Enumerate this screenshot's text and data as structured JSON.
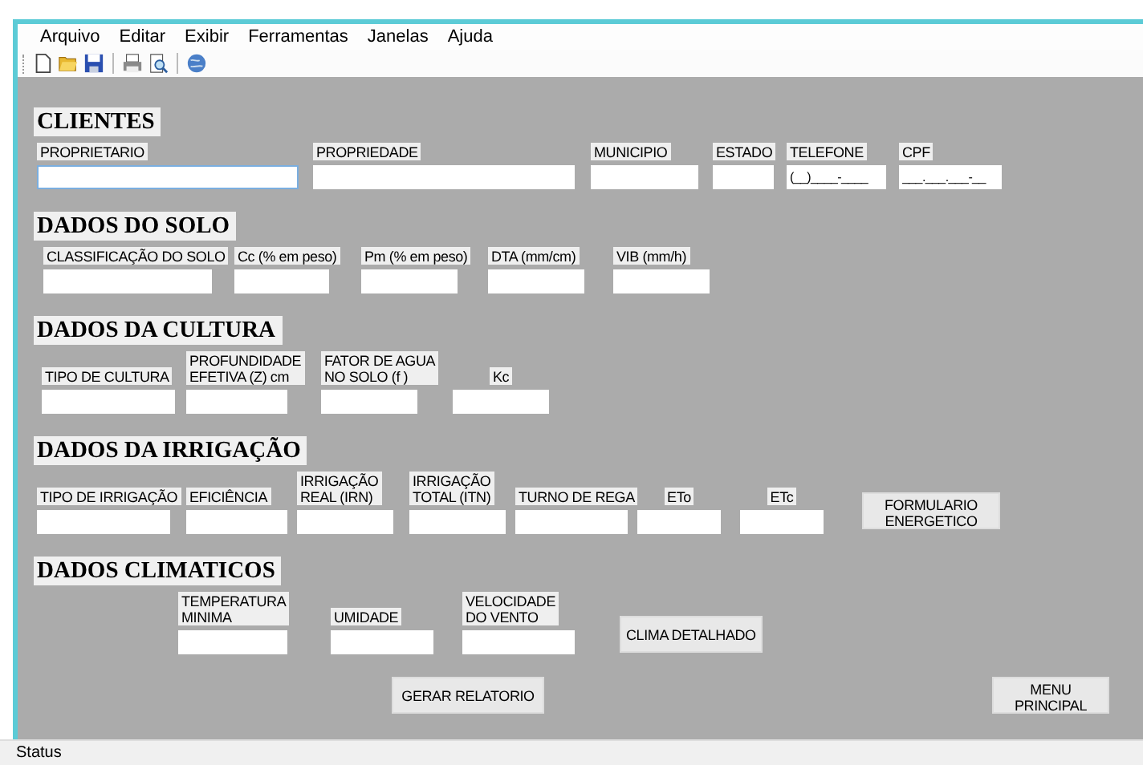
{
  "menu": [
    "Arquivo",
    "Editar",
    "Exibir",
    "Ferramentas",
    "Janelas",
    "Ajuda"
  ],
  "toolbar": [
    {
      "kind": "new"
    },
    {
      "kind": "open"
    },
    {
      "kind": "save"
    },
    {
      "kind": "separator"
    },
    {
      "kind": "print"
    },
    {
      "kind": "preview"
    },
    {
      "kind": "separator"
    },
    {
      "kind": "help"
    }
  ],
  "sections": [
    {
      "title": "CLIENTES",
      "fields": [
        {
          "label": [
            "PROPRIETARIO"
          ],
          "focused": true
        },
        {
          "label": [
            "PROPRIEDADE"
          ],
          "focused": false
        },
        {
          "label": [
            "MUNICIPIO"
          ],
          "focused": false
        },
        {
          "label": [
            "ESTADO"
          ],
          "focused": false
        },
        {
          "label": [
            "TELEFONE"
          ],
          "value": "(__)____-____",
          "focused": false
        },
        {
          "label": [
            "CPF"
          ],
          "value": "___.___.___-__",
          "focused": false
        }
      ]
    },
    {
      "title": "DADOS DO SOLO",
      "fields": [
        {
          "label": [
            "CLASSIFICAÇÃO DO SOLO"
          ],
          "focused": false
        },
        {
          "label": [
            "Cc (% em peso)"
          ],
          "focused": false
        },
        {
          "label": [
            "Pm (% em peso)"
          ],
          "focused": false
        },
        {
          "label": [
            "DTA  (mm/cm)"
          ],
          "focused": false
        },
        {
          "label": [
            "VIB  (mm/h)"
          ],
          "focused": false
        }
      ]
    },
    {
      "title": "DADOS DA CULTURA",
      "fields": [
        {
          "label": [
            "TIPO DE CULTURA"
          ],
          "focused": false
        },
        {
          "label": [
            "PROFUNDIDADE",
            "EFETIVA (Z) cm"
          ],
          "focused": false
        },
        {
          "label": [
            "FATOR DE AGUA",
            "NO SOLO (f )"
          ],
          "focused": false
        },
        {
          "label": [
            "Kc"
          ],
          "focused": false
        }
      ]
    },
    {
      "title": "DADOS DA IRRIGAÇÃO",
      "fields": [
        {
          "label": [
            "TIPO DE IRRIGAÇÃO"
          ],
          "focused": false
        },
        {
          "label": [
            "EFICIÊNCIA"
          ],
          "focused": false
        },
        {
          "label": [
            "IRRIGAÇÃO",
            "REAL (IRN)"
          ],
          "focused": false
        },
        {
          "label": [
            "IRRIGAÇÃO",
            "TOTAL (ITN)"
          ],
          "focused": false
        },
        {
          "label": [
            "TURNO DE REGA"
          ],
          "focused": false
        },
        {
          "label": [
            "ETo"
          ],
          "focused": false
        },
        {
          "label": [
            "ETc"
          ],
          "focused": false
        }
      ],
      "button": [
        "FORMULARIO",
        "ENERGETICO"
      ]
    },
    {
      "title": "DADOS CLIMATICOS",
      "fields": [
        {
          "label": [
            "TEMPERATURA",
            "MINIMA"
          ],
          "focused": false
        },
        {
          "label": [
            "UMIDADE"
          ],
          "focused": false
        },
        {
          "label": [
            "VELOCIDADE",
            "DO VENTO"
          ],
          "focused": false
        }
      ],
      "button": [
        "CLIMA DETALHADO"
      ]
    }
  ],
  "actions": [
    [
      "GERAR RELATORIO"
    ],
    [
      "MENU",
      "PRINCIPAL"
    ]
  ],
  "status_bar": "Status"
}
